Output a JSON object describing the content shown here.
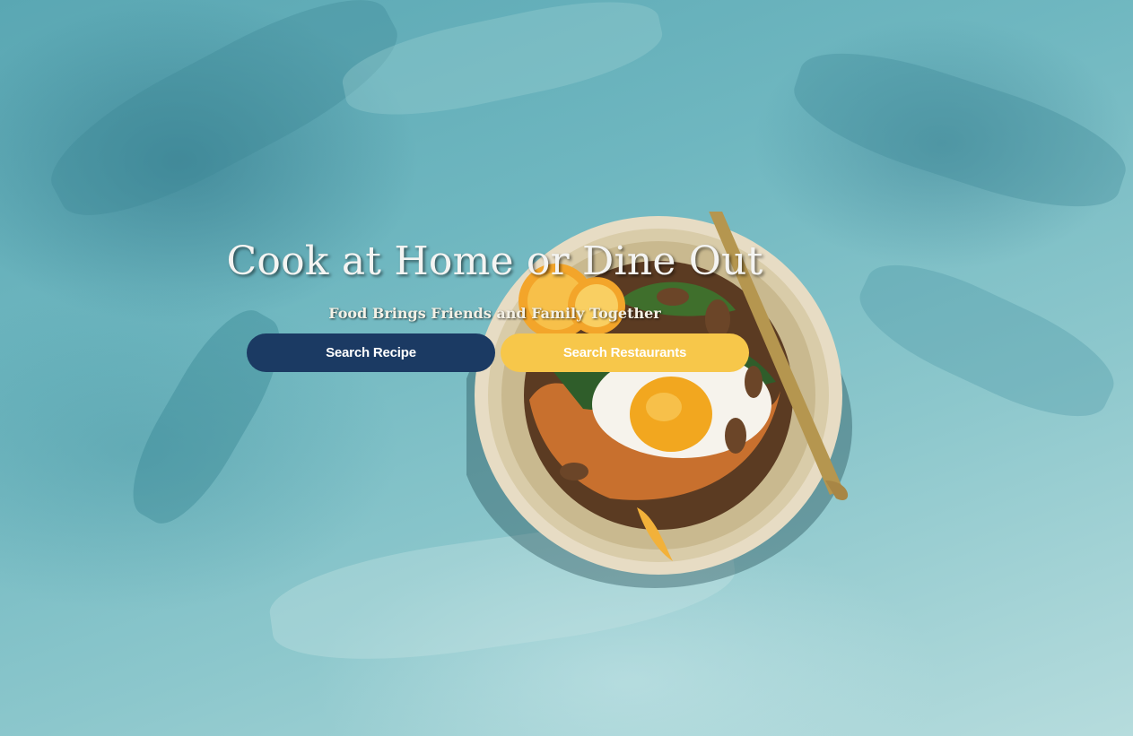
{
  "hero": {
    "title": "Cook at Home or Dine Out",
    "subtitle": "Food Brings Friends and Family Together",
    "background_color": "#6fb7c0"
  },
  "actions": {
    "search_recipe_label": "Search Recipe",
    "search_restaurants_label": "Search Restaurants",
    "recipe_color": "#1b3a63",
    "restaurants_color": "#f7c74a"
  }
}
